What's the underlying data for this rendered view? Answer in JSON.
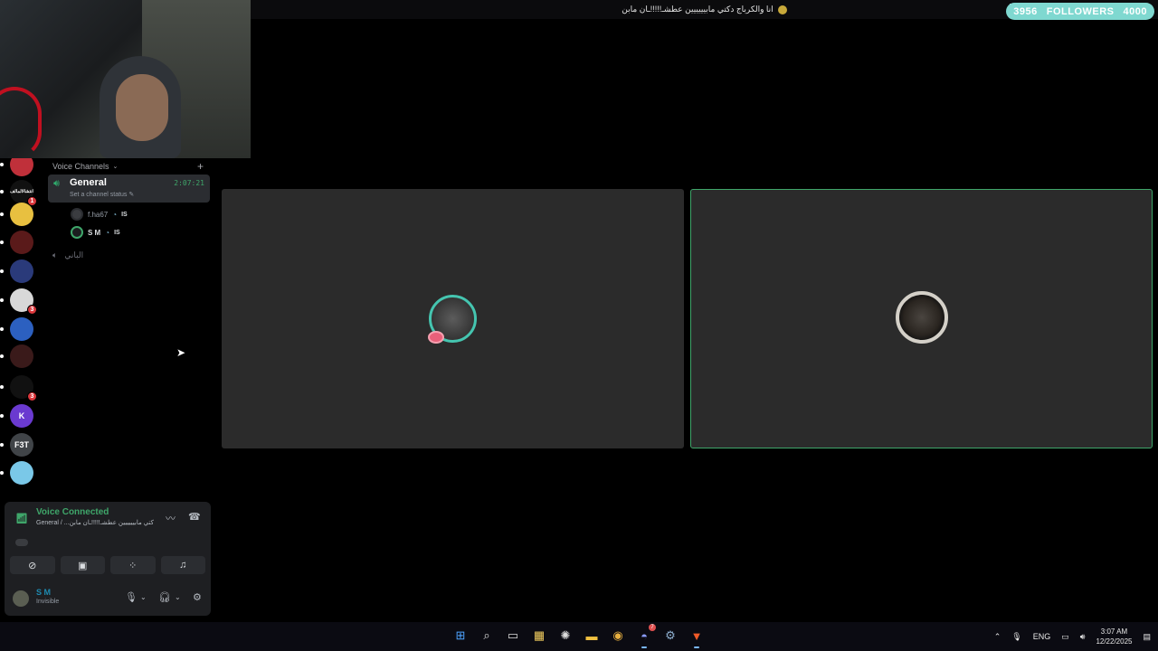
{
  "stream": {
    "title": "انا والكرباج دكتي مابيييييين عطشـ!!!!!ـان مابن",
    "followers_count": "3956",
    "followers_label": "FOLLOWERS",
    "followers_goal": "4000"
  },
  "servers": [
    {
      "label": "",
      "color": "#c0303a",
      "badge": ""
    },
    {
      "label": "انتشالالمالف",
      "color": "#111111",
      "badge": "1"
    },
    {
      "label": "",
      "color": "#e8c040",
      "badge": ""
    },
    {
      "label": "",
      "color": "#5a1a1a",
      "badge": ""
    },
    {
      "label": "",
      "color": "#2a3a7a",
      "badge": ""
    },
    {
      "label": "",
      "color": "#d8d8d8",
      "badge": "3"
    },
    {
      "label": "",
      "color": "#2c60c0",
      "badge": ""
    },
    {
      "label": "",
      "color": "#3a1a1a",
      "badge": ""
    },
    {
      "label": "",
      "color": "#111111",
      "badge": "3"
    },
    {
      "label": "K",
      "color": "#6a3ad0",
      "badge": ""
    },
    {
      "label": "F3T",
      "color": "#404448",
      "badge": ""
    },
    {
      "label": "",
      "color": "#7ac8e8",
      "badge": ""
    }
  ],
  "sidebar": {
    "section_label": "Voice Channels",
    "add_label": "+",
    "general": {
      "name": "General",
      "timer": "2:07:21",
      "status_placeholder": "Set a channel status"
    },
    "members": [
      {
        "name": "f.ha67",
        "live_label": "IS"
      },
      {
        "name": "S M",
        "live_label": "IS"
      }
    ],
    "other_channel": "الباني"
  },
  "voice_panel": {
    "title": "Voice Connected",
    "subtitle": "General / ...دكتي مابيييييين عطشـ!!!!!ـان مابن"
  },
  "user": {
    "name": "S M",
    "status": "Invisible"
  },
  "taskbar": {
    "lang": "ENG",
    "time": "3:07 AM",
    "date": "12/22/2025",
    "discord_badge": "7"
  },
  "colors": {
    "accent_green": "#3fa66a",
    "followers_bg": "#7fd8d0",
    "panel": "#1e1f22",
    "tile": "#2b2b2b"
  }
}
